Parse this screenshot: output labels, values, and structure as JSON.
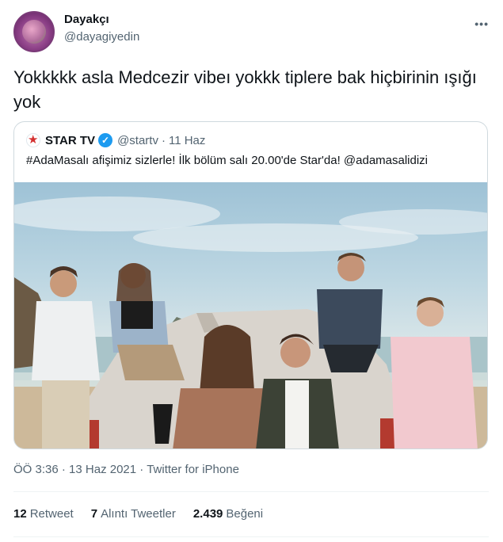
{
  "author": {
    "name": "Dayakçı",
    "handle": "@dayagiyedin",
    "avatar_icon": "profile-avatar",
    "more_label": "•••"
  },
  "tweet": {
    "text": "Yokkkkk asla Medcezir vibeı yokkk tiplere bak hiçbirinin ışığı yok"
  },
  "quoted": {
    "logo_icon": "star-tv-logo",
    "name": "STAR TV",
    "verified_icon": "verified-badge-icon",
    "handle": "@startv",
    "separator": "·",
    "date": "11 Haz",
    "text": "#AdaMasalı afişimiz sizlerle! İlk bölüm salı 20.00'de Star'da! @adamasalidizi",
    "image": "promo-poster-photo"
  },
  "meta": {
    "time": "ÖÖ 3:36",
    "sep1": "·",
    "date": "13 Haz 2021",
    "sep2": "·",
    "client": "Twitter for iPhone"
  },
  "stats": [
    {
      "count": "12",
      "label": "Retweet"
    },
    {
      "count": "7",
      "label": "Alıntı Tweetler"
    },
    {
      "count": "2.439",
      "label": "Beğeni"
    }
  ]
}
